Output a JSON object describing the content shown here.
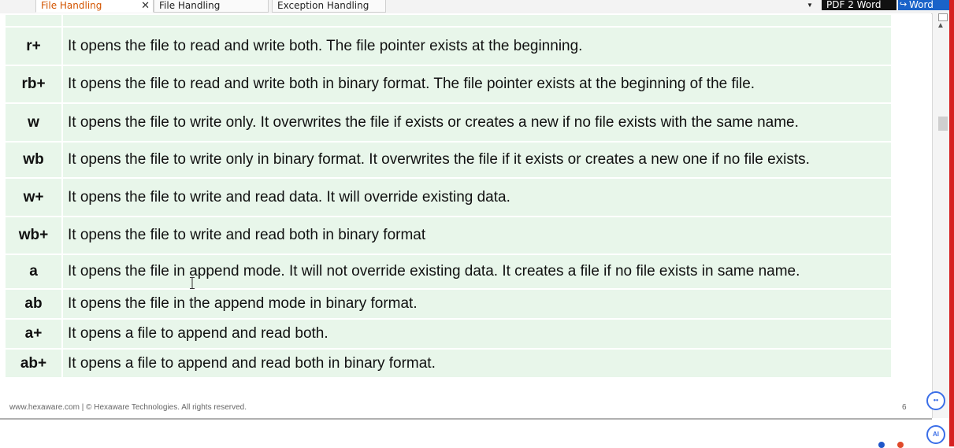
{
  "tabs": [
    {
      "label": "File Handling",
      "active": true,
      "closable": true,
      "close_glyph": "✕"
    },
    {
      "label": "File Handling",
      "active": false
    },
    {
      "label": "Exception Handling",
      "active": false
    }
  ],
  "toolbar": {
    "pdf_button": "PDF 2 Word",
    "word_button": "Word",
    "share_icon": "share-arrow-icon",
    "dropdown_icon": "caret-down-icon"
  },
  "table": {
    "rows": [
      {
        "mode": "r+",
        "description": "It opens the file to read and write both. The file pointer exists at the beginning."
      },
      {
        "mode": "rb+",
        "description": "It opens the file to read and write both in binary format. The file pointer exists at the beginning of the file."
      },
      {
        "mode": "w",
        "description": "It opens the file to write only. It overwrites the file if exists or creates a new if no file exists with the same name."
      },
      {
        "mode": "wb",
        "description": "It opens the file to write only in binary format. It overwrites the file if it exists or creates a new one if no file exists."
      },
      {
        "mode": "w+",
        "description": "It opens the file to write and read data. It will override existing data."
      },
      {
        "mode": "wb+",
        "description": "It opens the file to write and read both in binary format"
      },
      {
        "mode": "a",
        "description": "It opens the file in append mode. It will not override existing data. It creates a file if no file exists in same name."
      },
      {
        "mode": "ab",
        "description": "It opens the file in the append mode in binary format."
      },
      {
        "mode": "a+",
        "description": "It opens a file to append and read both."
      },
      {
        "mode": "ab+",
        "description": "It opens a file to append and read both in binary format."
      }
    ]
  },
  "footer": {
    "text": "www.hexaware.com  | © Hexaware Technologies. All rights reserved.",
    "page_number": "6"
  },
  "fabs": {
    "chat_icon": "chat-bot-icon",
    "chat_glyph": "••",
    "ai_icon": "ai-assistant-icon",
    "ai_label": "AI"
  },
  "colors": {
    "table_cell_bg": "#e8f6ea",
    "active_tab_text": "#d35400",
    "word_button_bg": "#1a63c9",
    "fab_accent": "#3a6ee8"
  }
}
